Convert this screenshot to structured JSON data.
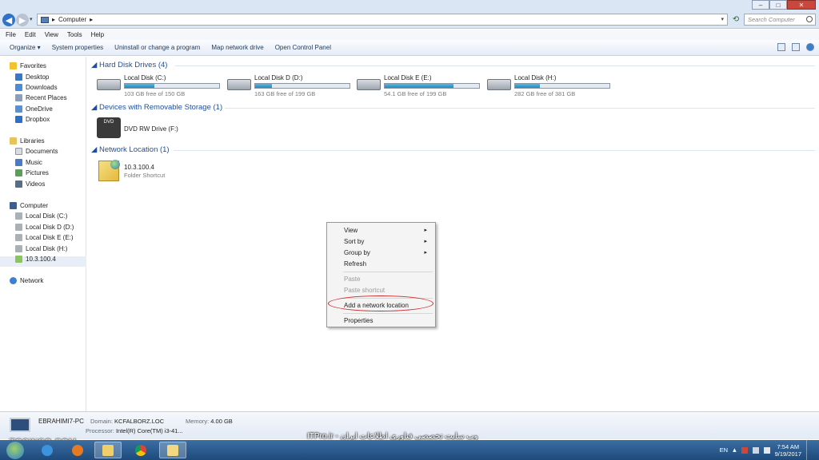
{
  "window": {
    "title": "Computer",
    "address_path": "Computer",
    "search_placeholder": "Search Computer",
    "controls": {
      "minimize": "‒",
      "maximize": "□",
      "close": "✕"
    }
  },
  "menubar": [
    "File",
    "Edit",
    "View",
    "Tools",
    "Help"
  ],
  "toolbar": {
    "organize": "Organize ▾",
    "items": [
      "System properties",
      "Uninstall or change a program",
      "Map network drive",
      "Open Control Panel"
    ]
  },
  "nav": {
    "favorites_header": "Favorites",
    "favorites": [
      "Desktop",
      "Downloads",
      "Recent Places",
      "OneDrive",
      "Dropbox"
    ],
    "libraries_header": "Libraries",
    "libraries": [
      "Documents",
      "Music",
      "Pictures",
      "Videos"
    ],
    "computer_header": "Computer",
    "computer": [
      "Local Disk (C:)",
      "Local Disk D (D:)",
      "Local Disk E (E:)",
      "Local Disk (H:)",
      "10.3.100.4"
    ],
    "network_header": "Network"
  },
  "groups": {
    "hard_disks": "Hard Disk Drives (4)",
    "removable": "Devices with Removable Storage (1)",
    "network": "Network Location (1)"
  },
  "drives": [
    {
      "name": "Local Disk (C:)",
      "free": "103 GB free of 150 GB",
      "used_fraction": 0.31
    },
    {
      "name": "Local Disk D (D:)",
      "free": "163 GB free of 199 GB",
      "used_fraction": 0.18
    },
    {
      "name": "Local Disk E (E:)",
      "free": "54.1 GB free of 199 GB",
      "used_fraction": 0.73
    },
    {
      "name": "Local Disk (H:)",
      "free": "282 GB free of 381 GB",
      "used_fraction": 0.26
    }
  ],
  "dvd": {
    "name": "DVD RW Drive (F:)",
    "icon_label": "DVD"
  },
  "network_location": {
    "name": "10.3.100.4",
    "type": "Folder Shortcut"
  },
  "context_menu": {
    "view": "View",
    "sort_by": "Sort by",
    "group_by": "Group by",
    "refresh": "Refresh",
    "paste": "Paste",
    "paste_shortcut": "Paste shortcut",
    "add_network_location": "Add a network location",
    "properties": "Properties",
    "submenu_arrow": "▸"
  },
  "details": {
    "pc_name": "EBRAHIMI7-PC",
    "domain_label": "Domain:",
    "domain": "KCFALBORZ.LOC",
    "memory_label": "Memory:",
    "memory": "4.00 GB",
    "processor_label": "Processor:",
    "processor": "Intel(R) Core(TM) i3-41..."
  },
  "watermarks": {
    "left": "TOSINSO.COM",
    "center": "ITPro.ir - وب سایت تخصصی فناوری اطلاعات ایران"
  },
  "taskbar": {
    "language": "EN",
    "time": "7:54 AM",
    "date": "9/19/2017"
  }
}
